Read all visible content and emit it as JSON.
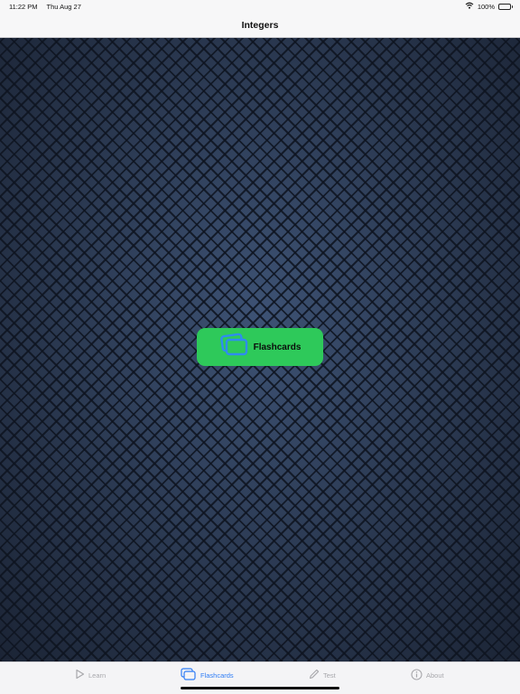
{
  "status_bar": {
    "time": "11:22 PM",
    "date": "Thu Aug 27",
    "battery": "100%",
    "wifi_icon": "wifi-icon",
    "battery_icon": "battery-icon"
  },
  "nav": {
    "title": "Integers"
  },
  "main": {
    "flashcards_button": {
      "label": "Flashcards",
      "icon": "flashcards-icon",
      "color": "#2ec95a",
      "icon_color": "#2f8cf0"
    }
  },
  "tabs": [
    {
      "label": "Learn",
      "icon": "play-icon",
      "active": false
    },
    {
      "label": "Flashcards",
      "icon": "flashcards-icon",
      "active": true
    },
    {
      "label": "Test",
      "icon": "pencil-icon",
      "active": false
    },
    {
      "label": "About",
      "icon": "info-icon",
      "active": false
    }
  ],
  "colors": {
    "accent": "#2f7df5",
    "inactive_tab": "#a8a8ac",
    "background": "#2c3a52"
  }
}
